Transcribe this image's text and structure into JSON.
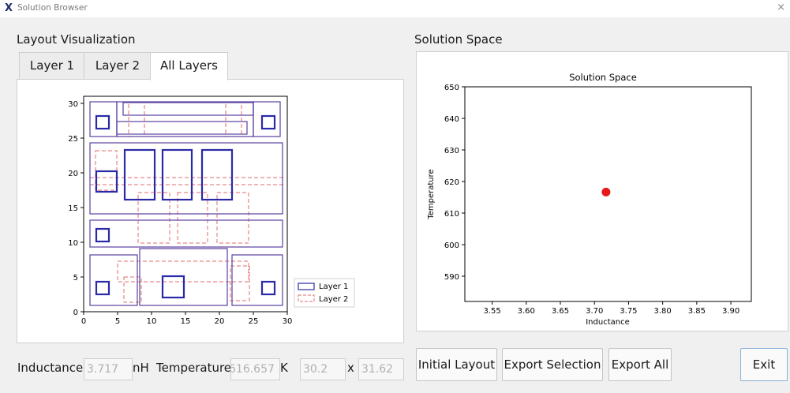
{
  "window": {
    "title": "Solution Browser",
    "close_glyph": "×",
    "app_icon": "x-logo-icon"
  },
  "layout_panel": {
    "title": "Layout Visualization",
    "tabs": [
      {
        "label": "Layer 1",
        "active": false
      },
      {
        "label": "Layer 2",
        "active": false
      },
      {
        "label": "All Layers",
        "active": true
      }
    ]
  },
  "layout_plot": {
    "x_ticks": [
      "0",
      "5",
      "10",
      "15",
      "20",
      "25",
      "30"
    ],
    "y_ticks": [
      "0",
      "5",
      "10",
      "15",
      "20",
      "25",
      "30"
    ],
    "legend": [
      "Layer 1",
      "Layer 2"
    ],
    "colors": {
      "layer1": "#2a2aa8",
      "layer1_outline": "#5b3fa0",
      "layer2": "#e36b6b"
    }
  },
  "solution_panel": {
    "title": "Solution Space",
    "chart_data": {
      "type": "scatter",
      "title": "Solution Space",
      "xlabel": "Inductance",
      "ylabel": "Temperature",
      "xlim": [
        3.51,
        3.93
      ],
      "ylim": [
        582,
        650
      ],
      "x_ticks": [
        3.55,
        3.6,
        3.65,
        3.7,
        3.75,
        3.8,
        3.85,
        3.9
      ],
      "y_ticks": [
        590,
        600,
        610,
        620,
        630,
        640,
        650
      ],
      "points": [
        {
          "x": 3.717,
          "y": 616.657
        }
      ],
      "point_color": "#e51b1b"
    }
  },
  "bottom": {
    "inductance_label": "Inductance",
    "inductance_value": "3.717",
    "inductance_unit": "nH",
    "temperature_label": "Temperature",
    "temperature_value": "616.657",
    "temperature_unit": "K",
    "dim_x_value": "30.2",
    "x_label": "x",
    "dim_y_value": "31.62"
  },
  "buttons": {
    "initial_layout": "Initial Layout",
    "export_selection": "Export Selection",
    "export_all": "Export All",
    "exit": "Exit"
  }
}
